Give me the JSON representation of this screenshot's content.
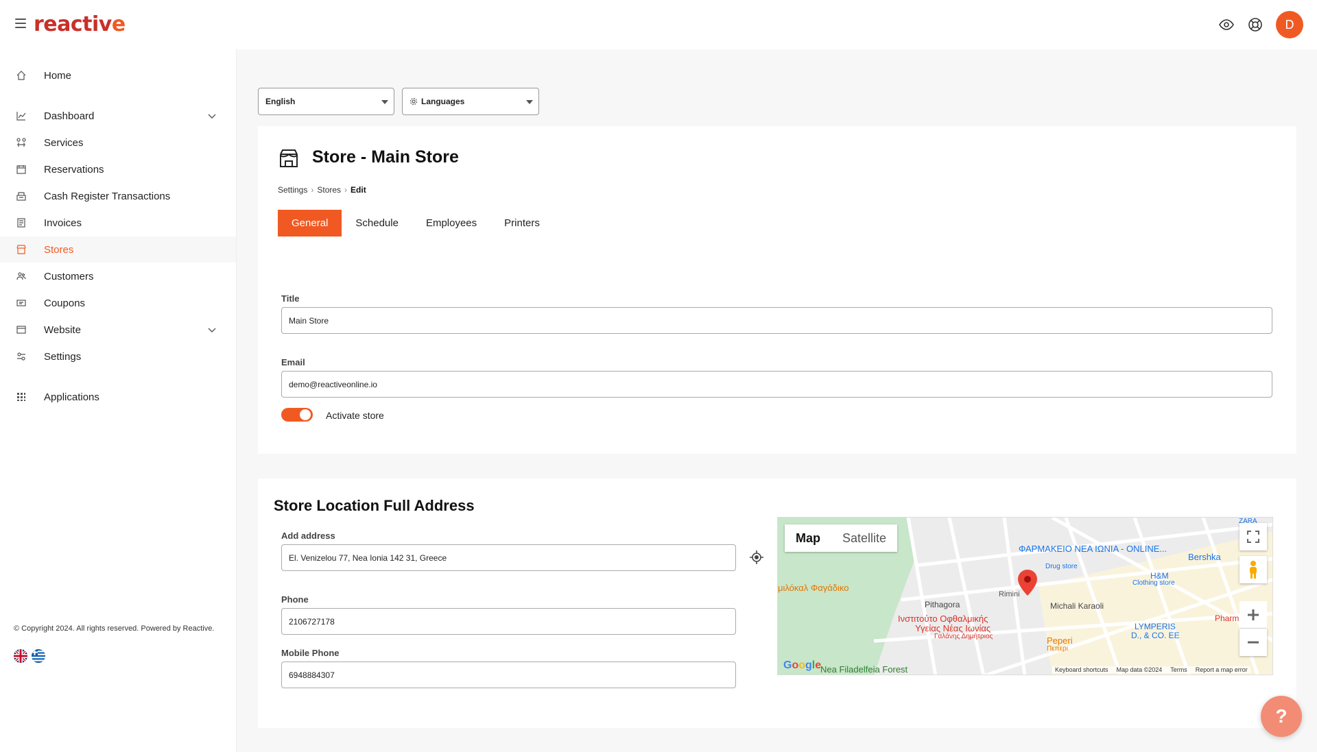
{
  "app": {
    "logo_text_main": "reactiv",
    "logo_text_end": "e",
    "avatar_initial": "D"
  },
  "header": {
    "icons": [
      "eye-icon",
      "support-icon"
    ]
  },
  "sidebar": {
    "items": [
      {
        "label": "Home",
        "icon": "home-icon"
      },
      {
        "label": "Dashboard",
        "icon": "chart-icon",
        "expandable": true
      },
      {
        "label": "Services",
        "icon": "services-icon"
      },
      {
        "label": "Reservations",
        "icon": "calendar-icon"
      },
      {
        "label": "Cash Register Transactions",
        "icon": "register-icon"
      },
      {
        "label": "Invoices",
        "icon": "invoice-icon"
      },
      {
        "label": "Stores",
        "icon": "store-icon",
        "active": true
      },
      {
        "label": "Customers",
        "icon": "customers-icon"
      },
      {
        "label": "Coupons",
        "icon": "coupon-icon"
      },
      {
        "label": "Website",
        "icon": "website-icon",
        "expandable": true
      },
      {
        "label": "Settings",
        "icon": "settings-icon"
      },
      {
        "label": "Applications",
        "icon": "grid-icon"
      }
    ],
    "copyright": "© Copyright 2024. All rights reserved. Powered by Reactive.",
    "languages": [
      "en",
      "el"
    ]
  },
  "lang_select": {
    "value": "English"
  },
  "languages_button": {
    "label": "Languages"
  },
  "page": {
    "title": "Store - Main Store",
    "breadcrumb": [
      "Settings",
      "Stores",
      "Edit"
    ],
    "tabs": [
      "General",
      "Schedule",
      "Employees",
      "Printers"
    ],
    "active_tab": "General"
  },
  "general": {
    "title_label": "Title",
    "title_value": "Main Store",
    "email_label": "Email",
    "email_value": "demo@reactiveonline.io",
    "activate_label": "Activate store",
    "activate_on": true
  },
  "location": {
    "section_title": "Store Location Full Address",
    "address_label": "Add address",
    "address_value": "El. Venizelou 77, Nea Ionia 142 31, Greece",
    "phone_label": "Phone",
    "phone_value": "2106727178",
    "mobile_label": "Mobile Phone",
    "mobile_value": "6948884307"
  },
  "map": {
    "toggle_map": "Map",
    "toggle_satellite": "Satellite",
    "labels": {
      "pharmacy": "ΦΑΡΜΑΚΕΙΟ ΝΕΑ ΙΩΝΙΑ - ONLINE...",
      "drug_store": "Drug store",
      "bershka": "Bershka",
      "hm": "H&M",
      "clothing": "Clothing store",
      "rimini": "Rimini",
      "pithagora": "Pithagora",
      "michali": "Michali Karaoli",
      "institute_1": "Ινστιτούτο Οφθαλμικής",
      "institute_2": "Υγείας Νέας Ιωνίας",
      "galanis": "Γαλάνης Δημήτριος",
      "lymperis_1": "LYMPERIS",
      "lymperis_2": "D., & CO. EE",
      "peperi": "Peperi",
      "peperi_gr": "Πεπερι",
      "souvlaki": "μιλόκαλ Φαγάδικο",
      "forest": "Nea Filadelfeia Forest",
      "zara": "ZARA",
      "pharm": "Pharm"
    },
    "footer": [
      "Keyboard shortcuts",
      "Map data ©2024",
      "Terms",
      "Report a map error"
    ],
    "google": "Google"
  },
  "help": {
    "label": "?"
  },
  "colors": {
    "accent": "#f05a22",
    "logo_red": "#c8302a"
  }
}
